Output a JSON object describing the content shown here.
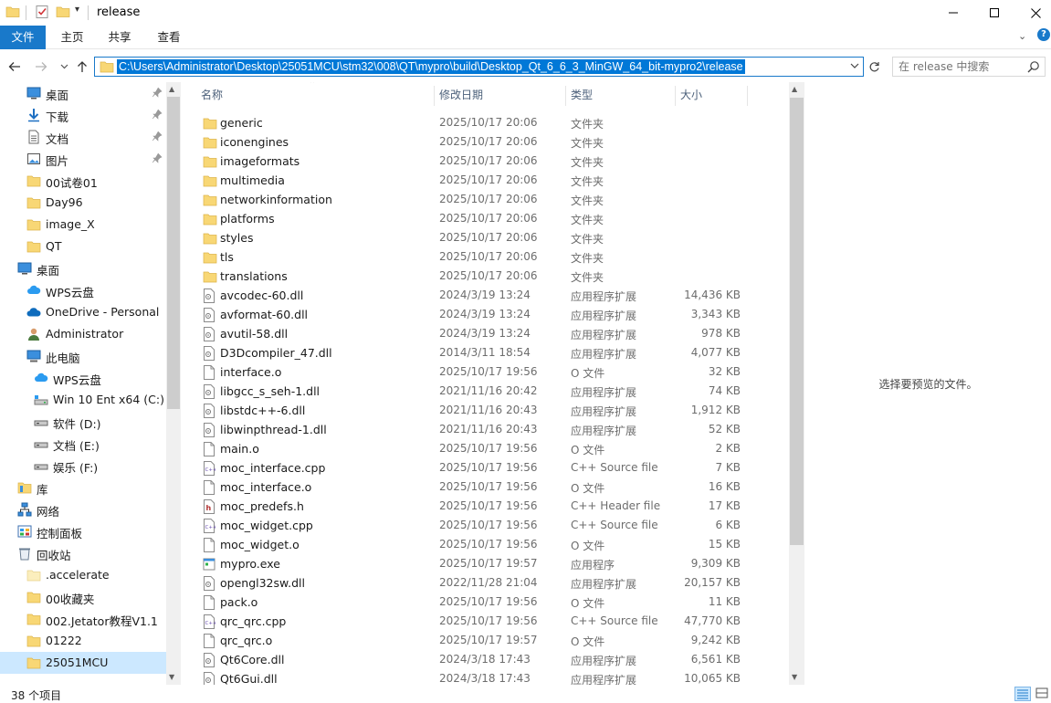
{
  "window": {
    "title": "release"
  },
  "ribbon": {
    "tabs": [
      "文件",
      "主页",
      "共享",
      "查看"
    ]
  },
  "address": {
    "path": "C:\\Users\\Administrator\\Desktop\\25051MCU\\stm32\\008\\QT\\mypro\\build\\Desktop_Qt_6_6_3_MinGW_64_bit-mypro2\\release"
  },
  "search": {
    "placeholder": "在 release 中搜索"
  },
  "navpane": {
    "items": [
      {
        "label": "桌面",
        "icon": "desktop-icon",
        "pinned": true
      },
      {
        "label": "下载",
        "icon": "download-icon",
        "pinned": true
      },
      {
        "label": "文档",
        "icon": "document-icon",
        "pinned": true
      },
      {
        "label": "图片",
        "icon": "picture-icon",
        "pinned": true
      },
      {
        "label": "00试卷01",
        "icon": "folder-icon"
      },
      {
        "label": "Day96",
        "icon": "folder-icon"
      },
      {
        "label": "image_X",
        "icon": "folder-icon"
      },
      {
        "label": "QT",
        "icon": "folder-icon"
      },
      {
        "label": "桌面",
        "icon": "desktop-icon"
      },
      {
        "label": "WPS云盘",
        "icon": "cloud-icon"
      },
      {
        "label": "OneDrive - Personal",
        "icon": "onedrive-icon"
      },
      {
        "label": "Administrator",
        "icon": "user-icon"
      },
      {
        "label": "此电脑",
        "icon": "computer-icon"
      },
      {
        "label": "WPS云盘",
        "icon": "cloud-icon"
      },
      {
        "label": "Win 10 Ent x64 (C:)",
        "icon": "system-drive-icon"
      },
      {
        "label": "软件 (D:)",
        "icon": "drive-icon"
      },
      {
        "label": "文档 (E:)",
        "icon": "drive-icon"
      },
      {
        "label": "娱乐 (F:)",
        "icon": "drive-icon"
      },
      {
        "label": "库",
        "icon": "library-icon"
      },
      {
        "label": "网络",
        "icon": "network-icon"
      },
      {
        "label": "控制面板",
        "icon": "control-panel-icon"
      },
      {
        "label": "回收站",
        "icon": "recycle-bin-icon"
      },
      {
        "label": ".accelerate",
        "icon": "folder-light-icon"
      },
      {
        "label": "00收藏夹",
        "icon": "folder-icon"
      },
      {
        "label": "002.Jetator教程V1.1",
        "icon": "folder-icon"
      },
      {
        "label": "01222",
        "icon": "folder-icon"
      },
      {
        "label": "25051MCU",
        "icon": "folder-icon",
        "selected": true
      }
    ]
  },
  "columns": {
    "name": "名称",
    "date": "修改日期",
    "type": "类型",
    "size": "大小"
  },
  "files": [
    {
      "name": "generic",
      "date": "2025/10/17 20:06",
      "type": "文件夹",
      "size": "",
      "icon": "folder-icon"
    },
    {
      "name": "iconengines",
      "date": "2025/10/17 20:06",
      "type": "文件夹",
      "size": "",
      "icon": "folder-icon"
    },
    {
      "name": "imageformats",
      "date": "2025/10/17 20:06",
      "type": "文件夹",
      "size": "",
      "icon": "folder-icon"
    },
    {
      "name": "multimedia",
      "date": "2025/10/17 20:06",
      "type": "文件夹",
      "size": "",
      "icon": "folder-icon"
    },
    {
      "name": "networkinformation",
      "date": "2025/10/17 20:06",
      "type": "文件夹",
      "size": "",
      "icon": "folder-icon"
    },
    {
      "name": "platforms",
      "date": "2025/10/17 20:06",
      "type": "文件夹",
      "size": "",
      "icon": "folder-icon"
    },
    {
      "name": "styles",
      "date": "2025/10/17 20:06",
      "type": "文件夹",
      "size": "",
      "icon": "folder-icon"
    },
    {
      "name": "tls",
      "date": "2025/10/17 20:06",
      "type": "文件夹",
      "size": "",
      "icon": "folder-icon"
    },
    {
      "name": "translations",
      "date": "2025/10/17 20:06",
      "type": "文件夹",
      "size": "",
      "icon": "folder-icon"
    },
    {
      "name": "avcodec-60.dll",
      "date": "2024/3/19 13:24",
      "type": "应用程序扩展",
      "size": "14,436 KB",
      "icon": "dll-icon"
    },
    {
      "name": "avformat-60.dll",
      "date": "2024/3/19 13:24",
      "type": "应用程序扩展",
      "size": "3,343 KB",
      "icon": "dll-icon"
    },
    {
      "name": "avutil-58.dll",
      "date": "2024/3/19 13:24",
      "type": "应用程序扩展",
      "size": "978 KB",
      "icon": "dll-icon"
    },
    {
      "name": "D3Dcompiler_47.dll",
      "date": "2014/3/11 18:54",
      "type": "应用程序扩展",
      "size": "4,077 KB",
      "icon": "dll-icon"
    },
    {
      "name": "interface.o",
      "date": "2025/10/17 19:56",
      "type": "O 文件",
      "size": "32 KB",
      "icon": "file-icon"
    },
    {
      "name": "libgcc_s_seh-1.dll",
      "date": "2021/11/16 20:42",
      "type": "应用程序扩展",
      "size": "74 KB",
      "icon": "dll-icon"
    },
    {
      "name": "libstdc++-6.dll",
      "date": "2021/11/16 20:43",
      "type": "应用程序扩展",
      "size": "1,912 KB",
      "icon": "dll-icon"
    },
    {
      "name": "libwinpthread-1.dll",
      "date": "2021/11/16 20:43",
      "type": "应用程序扩展",
      "size": "52 KB",
      "icon": "dll-icon"
    },
    {
      "name": "main.o",
      "date": "2025/10/17 19:56",
      "type": "O 文件",
      "size": "2 KB",
      "icon": "file-icon"
    },
    {
      "name": "moc_interface.cpp",
      "date": "2025/10/17 19:56",
      "type": "C++ Source file",
      "size": "7 KB",
      "icon": "cpp-icon"
    },
    {
      "name": "moc_interface.o",
      "date": "2025/10/17 19:56",
      "type": "O 文件",
      "size": "16 KB",
      "icon": "file-icon"
    },
    {
      "name": "moc_predefs.h",
      "date": "2025/10/17 19:56",
      "type": "C++ Header file",
      "size": "17 KB",
      "icon": "header-icon"
    },
    {
      "name": "moc_widget.cpp",
      "date": "2025/10/17 19:56",
      "type": "C++ Source file",
      "size": "6 KB",
      "icon": "cpp-icon"
    },
    {
      "name": "moc_widget.o",
      "date": "2025/10/17 19:56",
      "type": "O 文件",
      "size": "15 KB",
      "icon": "file-icon"
    },
    {
      "name": "mypro.exe",
      "date": "2025/10/17 19:57",
      "type": "应用程序",
      "size": "9,309 KB",
      "icon": "exe-icon"
    },
    {
      "name": "opengl32sw.dll",
      "date": "2022/11/28 21:04",
      "type": "应用程序扩展",
      "size": "20,157 KB",
      "icon": "dll-icon"
    },
    {
      "name": "pack.o",
      "date": "2025/10/17 19:56",
      "type": "O 文件",
      "size": "11 KB",
      "icon": "file-icon"
    },
    {
      "name": "qrc_qrc.cpp",
      "date": "2025/10/17 19:56",
      "type": "C++ Source file",
      "size": "47,770 KB",
      "icon": "cpp-icon"
    },
    {
      "name": "qrc_qrc.o",
      "date": "2025/10/17 19:57",
      "type": "O 文件",
      "size": "9,242 KB",
      "icon": "file-icon"
    },
    {
      "name": "Qt6Core.dll",
      "date": "2024/3/18 17:43",
      "type": "应用程序扩展",
      "size": "6,561 KB",
      "icon": "dll-icon"
    },
    {
      "name": "Qt6Gui.dll",
      "date": "2024/3/18 17:43",
      "type": "应用程序扩展",
      "size": "10,065 KB",
      "icon": "dll-icon"
    }
  ],
  "preview": {
    "message": "选择要预览的文件。"
  },
  "status": {
    "item_count": "38 个项目"
  },
  "colors": {
    "accent": "#1979ca",
    "selection": "#0078d7",
    "folder": "#f8d775"
  }
}
